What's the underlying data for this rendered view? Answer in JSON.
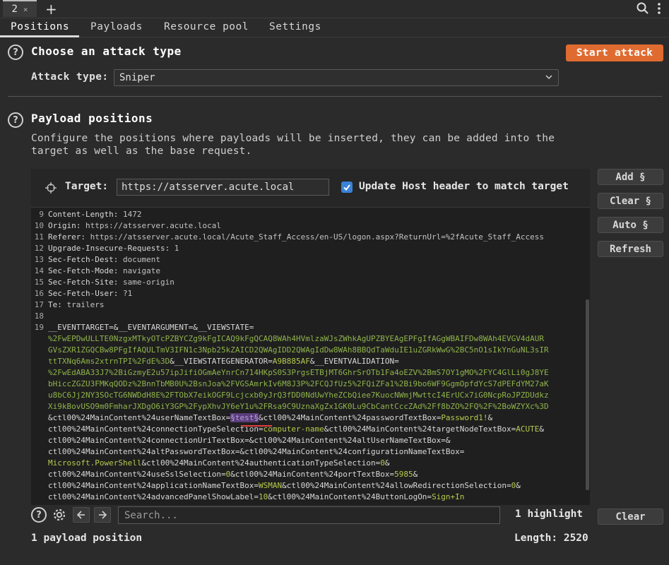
{
  "tabstrip": {
    "tab_number": "2",
    "close_glyph": "×",
    "add_glyph": "+"
  },
  "subtabs": [
    "Positions",
    "Payloads",
    "Resource pool",
    "Settings"
  ],
  "attack_section": {
    "title": "Choose an attack type",
    "start_button": "Start attack",
    "type_label": "Attack type:",
    "type_value": "Sniper"
  },
  "positions_section": {
    "title": "Payload positions",
    "description": "Configure the positions where payloads will be inserted, they can be added into the target as well as the base request."
  },
  "target": {
    "label": "Target:",
    "value": "https://atsserver.acute.local",
    "update_host_label": "Update Host header to match target",
    "update_host_checked": true
  },
  "side_buttons": {
    "add": "Add §",
    "clear": "Clear §",
    "auto": "Auto §",
    "refresh": "Refresh"
  },
  "request_lines": [
    {
      "n": "9",
      "key": "Content-Length",
      "val": " 1472"
    },
    {
      "n": "10",
      "key": "Origin",
      "val": " https://atsserver.acute.local"
    },
    {
      "n": "11",
      "key": "Referer",
      "val": " https://atsserver.acute.local/Acute_Staff_Access/en-US/logon.aspx?ReturnUrl=%2fAcute_Staff_Access"
    },
    {
      "n": "12",
      "key": "Upgrade-Insecure-Requests",
      "val": " 1"
    },
    {
      "n": "13",
      "key": "Sec-Fetch-Dest",
      "val": " document"
    },
    {
      "n": "14",
      "key": "Sec-Fetch-Mode",
      "val": " navigate"
    },
    {
      "n": "15",
      "key": "Sec-Fetch-Site",
      "val": " same-origin"
    },
    {
      "n": "16",
      "key": "Sec-Fetch-User",
      "val": " ?1"
    },
    {
      "n": "17",
      "key": "Te",
      "val": " trailers"
    },
    {
      "n": "18",
      "key": "",
      "val": ""
    },
    {
      "n": "19",
      "key": "",
      "val": ""
    }
  ],
  "body_lines": {
    "l1_a": "__EVENTTARGET=&__EVENTARGUMENT=&__VIEWSTATE=",
    "l2": "%2FwEPDwULLTE0NzgxMTkyOTcPZBYCZg9kFgICAQ9kFgQCAQ8WAh4HVmlzaWJsZWhkAgUPZBYEAgEPFgIfAGgWBAIFDw8WAh4EVGV4dAUR",
    "l3": "GVsZXR1ZGQCBw8PFgIfAQULTmV3IFN1c3Npb25kZAICD2QWAgIDD2QWAgIdDw8WAh8BBQdTaWduIE1uZGRkWwG%2BC5nO1sIkYnGuNL3sIR",
    "l4": "ttTXNq6Ams2xtrnTPI%2FdE%3D",
    "l4_a": "&__VIEWSTATEGENERATOR=",
    "l4_b": "A9B885AF",
    "l4_c": "&__EVENTVALIDATION=",
    "l5": "%2FwEdABA33J7%2BiGzmyE2u57ipJifiOGmAeYnrCn714HKpS0S3PrgsETBjMT6GhrSrOTb1Fa4oEZV%2BmS7OY1gMO%2FYC4GlLi0gJ8YE",
    "l6": "bHiccZGZU3FMKqQODz%2BnnTbMB0U%2BsnJoa%2FVGSAmrkIv6M8J3P%2FCQJfUz5%2FQiZFa1%2Bi9bo6WF9GgmOpfdYcS7dPEFdYM27aK",
    "l7": "u8bC6Jj2NY3SOcTG6NWDdH8E%2FTObX7eikOGF9Lcjcxb0yJrQ3fDD0NdUwYheZCbQiee7KuocNWmjMwttcI4ErUCx7iG0NcpRoJPZDUdkz",
    "l8": "Xi9kBovUSO9m0FmharJXDgO6iY3GP%2FypXhvJY6eY1u%2FRsa9C9UznaXgZx1GK0Lu9CbCantCccZAd%2Ff8bZO%2FQ%2F%2BoWZYXc%3D",
    "l9_a": "&ctl00%24MainContent%24userNameTextBox=",
    "l9_marker": "§test§",
    "l9_b": "&ctl00%24MainContent%24passwordTextBox=",
    "l9_c": "Password1!",
    "l9_d": "&",
    "l10_a": "ctl00%24MainContent%24connectionTypeSelection=",
    "l10_b": "computer-name",
    "l10_c": "&ctl00%24MainContent%24targetNodeTextBox=",
    "l10_d": "ACUTE",
    "l10_e": "&",
    "l11": "ctl00%24MainContent%24connectionUriTextBox=&ctl00%24MainContent%24altUserNameTextBox=&",
    "l12": "ctl00%24MainContent%24altPasswordTextBox=&ctl00%24MainContent%24configurationNameTextBox=",
    "l13_a": "Microsoft.PowerShell",
    "l13_b": "&ctl00%24MainContent%24authenticationTypeSelection=",
    "l13_c": "0",
    "l13_d": "&",
    "l14_a": "ctl00%24MainContent%24useSslSelection=",
    "l14_b": "0",
    "l14_c": "&ctl00%24MainContent%24portTextBox=",
    "l14_d": "5985",
    "l14_e": "&",
    "l15_a": "ctl00%24MainContent%24applicationNameTextBox=",
    "l15_b": "WSMAN",
    "l15_c": "&ctl00%24MainContent%24allowRedirectionSelection=",
    "l15_d": "0",
    "l15_e": "&",
    "l16_a": "ctl00%24MainContent%24advancedPanelShowLabel=",
    "l16_b": "10",
    "l16_c": "&ctl00%24MainContent%24ButtonLogOn=",
    "l16_d": "Sign+In"
  },
  "search": {
    "placeholder": "Search...",
    "value": "",
    "highlight_count": "1 highlight",
    "clear": "Clear"
  },
  "footer": {
    "positions": "1 payload position",
    "length": "Length: 2520"
  },
  "colors": {
    "accent": "#e06b30",
    "checkbox": "#3b82d6",
    "param_value": "#8fb34a",
    "marker_bg": "#5a3c7a"
  },
  "icons": [
    "search-icon",
    "kebab-menu-icon",
    "help-icon",
    "chevron-down-icon",
    "crosshair-icon",
    "checkmark-icon",
    "gear-icon",
    "arrow-left-icon",
    "arrow-right-icon"
  ]
}
